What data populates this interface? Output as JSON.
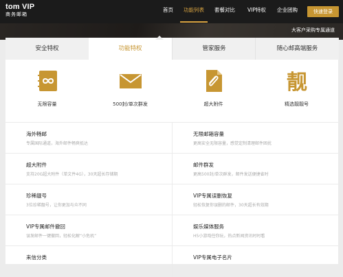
{
  "header": {
    "logo_top": "tom VIP",
    "logo_bottom": "商务邮箱",
    "nav": [
      {
        "label": "首页"
      },
      {
        "label": "功能列表"
      },
      {
        "label": "套餐对比"
      },
      {
        "label": "VIP特权"
      },
      {
        "label": "企业团购"
      }
    ],
    "active_nav": "功能列表",
    "login_label": "快速登录",
    "accent": "#c79632"
  },
  "hero": {
    "text": "大客户采购专属通道"
  },
  "tabs": [
    {
      "label": "安全特权"
    },
    {
      "label": "功能特权"
    },
    {
      "label": "管家服务"
    },
    {
      "label": "随心邮高端服务"
    }
  ],
  "active_tab": "功能特权",
  "features": [
    {
      "icon": "infinity-notebook-icon",
      "label": "无限容量"
    },
    {
      "icon": "envelope-icon",
      "label": "500封/单次群发"
    },
    {
      "icon": "paperclip-file-icon",
      "label": "超大附件"
    },
    {
      "icon": "靓",
      "label": "精选靓靓号"
    }
  ],
  "items": [
    {
      "title": "海外畅邮",
      "desc": "专属国际通道，海外邮件畅爽抵达"
    },
    {
      "title": "无限邮箱容量",
      "desc": "更高安全无限容量，感觉定制清理邮件困扰"
    },
    {
      "title": "超大附件",
      "desc": "支持20G超大附件（单文件4G），30天超长存储期"
    },
    {
      "title": "邮件群发",
      "desc": "更高500封/单次群发，邮件发送便捷省时"
    },
    {
      "title": "珍稀靓号",
      "desc": "3位珍稀靓号，让你更加与众不同"
    },
    {
      "title": "VIP专属误删恢复",
      "desc": "轻松恢复你误删的邮件，30天超长有效期"
    },
    {
      "title": "VIP专属邮件撤回",
      "desc": "误发邮件一键撤回，轻松化解“小危机”"
    },
    {
      "title": "娱乐媒体服务",
      "desc": "H5小游戏任你玩，热点新闻资讯时时看"
    },
    {
      "title": "来信分类",
      "desc": ""
    },
    {
      "title": "VIP专属电子名片",
      "desc": ""
    }
  ]
}
